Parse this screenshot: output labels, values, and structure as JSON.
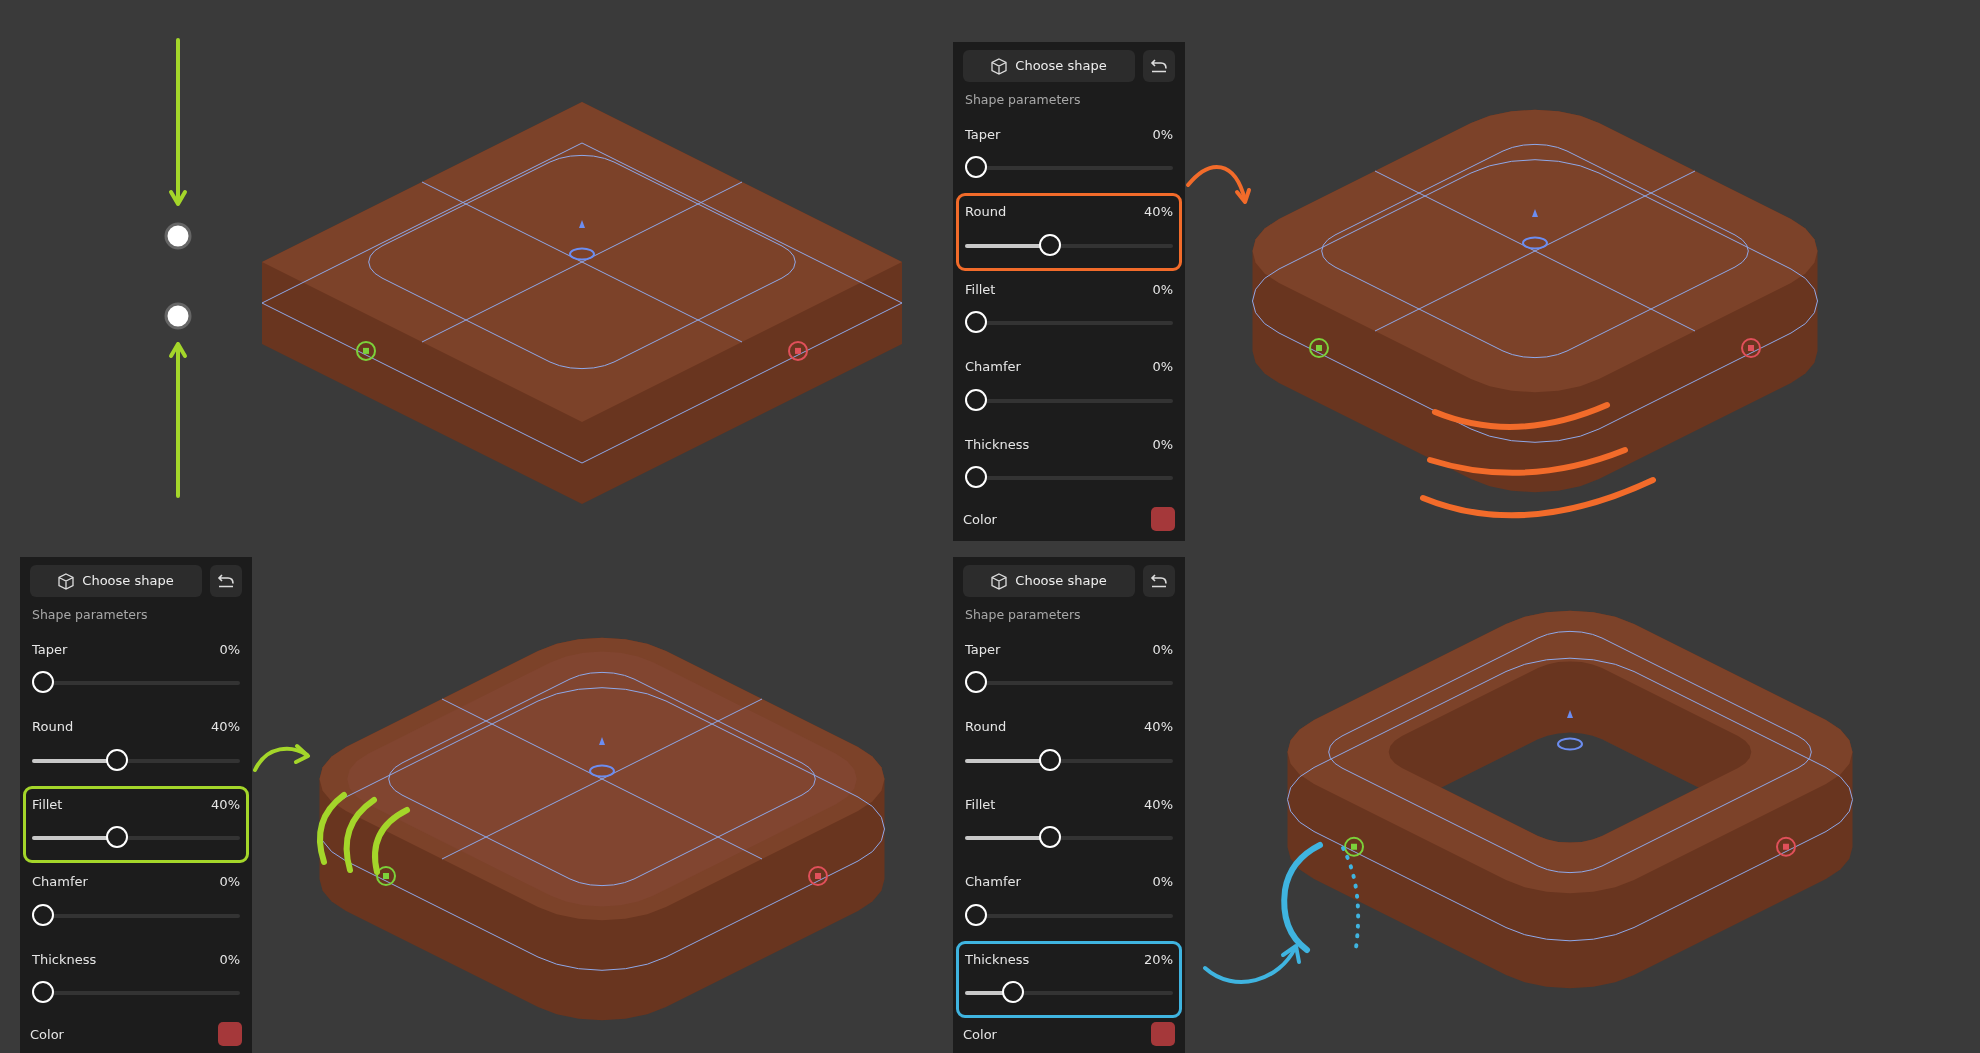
{
  "scenes": [
    {
      "kind": "box",
      "color": "#a4d62a"
    },
    {
      "kind": "rounded",
      "color": "#f26b2a",
      "panel": {
        "button": "Choose shape",
        "section": "Shape parameters",
        "sliders": [
          {
            "label": "Taper",
            "reading": "0%",
            "level": 0,
            "highlighted": false
          },
          {
            "label": "Round",
            "reading": "40%",
            "level": 0.4,
            "highlighted": true
          },
          {
            "label": "Fillet",
            "reading": "0%",
            "level": 0,
            "highlighted": false
          },
          {
            "label": "Chamfer",
            "reading": "0%",
            "level": 0,
            "highlighted": false
          },
          {
            "label": "Thickness",
            "reading": "0%",
            "level": 0,
            "highlighted": false
          }
        ],
        "color_row": {
          "label": "Color",
          "color": "#a5383a"
        }
      }
    },
    {
      "kind": "filleted",
      "color": "#a4d62a",
      "panel": {
        "button": "Choose shape",
        "section": "Shape parameters",
        "sliders": [
          {
            "label": "Taper",
            "reading": "0%",
            "level": 0,
            "highlighted": false
          },
          {
            "label": "Round",
            "reading": "40%",
            "level": 0.4,
            "highlighted": false
          },
          {
            "label": "Fillet",
            "reading": "40%",
            "level": 0.4,
            "highlighted": true
          },
          {
            "label": "Chamfer",
            "reading": "0%",
            "level": 0,
            "highlighted": false
          },
          {
            "label": "Thickness",
            "reading": "0%",
            "level": 0,
            "highlighted": false
          }
        ],
        "color_row": {
          "label": "Color",
          "color": "#a5383a"
        }
      }
    },
    {
      "kind": "ring",
      "color": "#3fb4e0",
      "panel": {
        "button": "Choose shape",
        "section": "Shape parameters",
        "sliders": [
          {
            "label": "Taper",
            "reading": "0%",
            "level": 0,
            "highlighted": false
          },
          {
            "label": "Round",
            "reading": "40%",
            "level": 0.4,
            "highlighted": false
          },
          {
            "label": "Fillet",
            "reading": "40%",
            "level": 0.4,
            "highlighted": false
          },
          {
            "label": "Chamfer",
            "reading": "0%",
            "level": 0,
            "highlighted": false
          },
          {
            "label": "Thickness",
            "reading": "20%",
            "level": 0.2,
            "highlighted": true
          }
        ],
        "color_row": {
          "label": "Color",
          "color": "#a5383a"
        }
      }
    }
  ]
}
